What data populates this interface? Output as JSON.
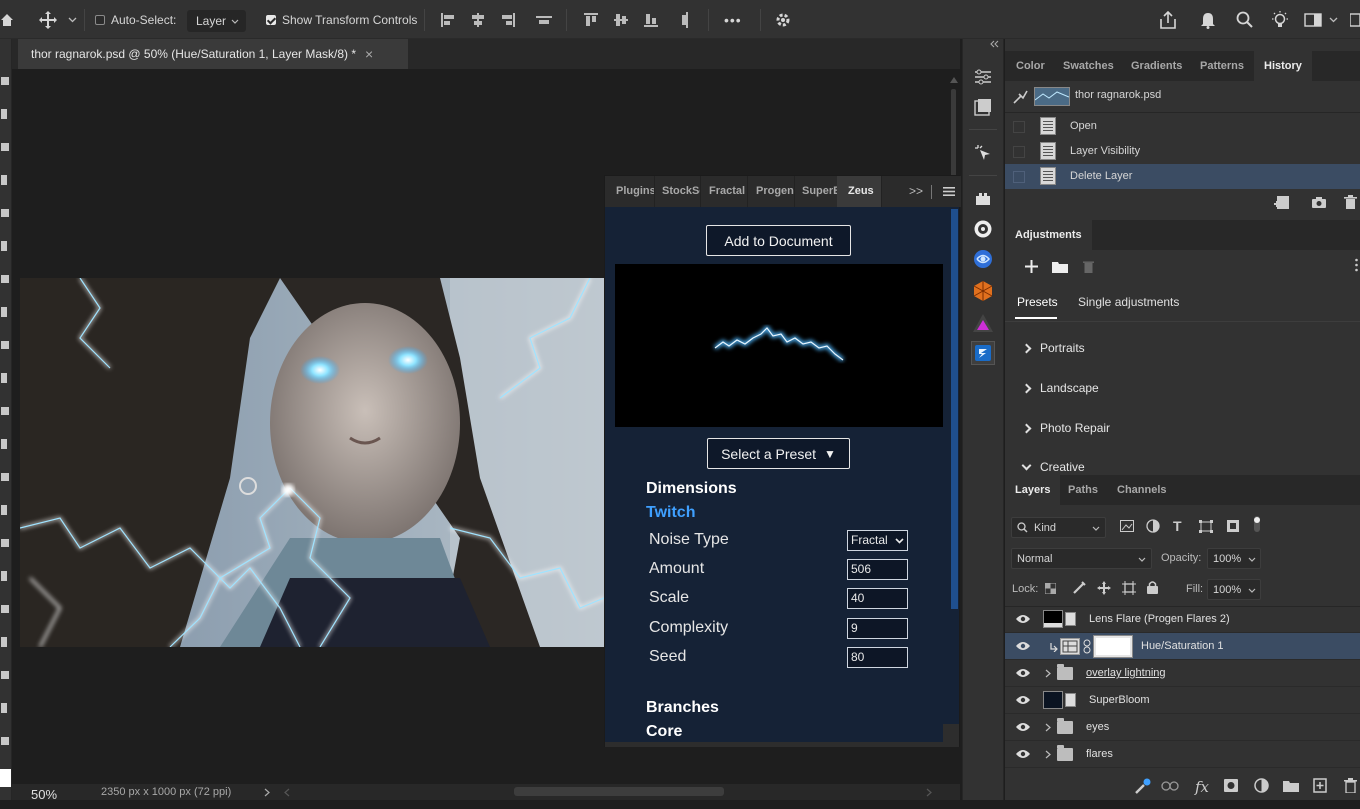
{
  "options_bar": {
    "auto_select_label": "Auto-Select:",
    "layer_select": "Layer",
    "show_transform_label": "Show Transform Controls",
    "more_label": "•••"
  },
  "document": {
    "tab_title": "thor ragnarok.psd @ 50% (Hue/Saturation 1, Layer Mask/8) *",
    "close_glyph": "×"
  },
  "status": {
    "zoom": "50%",
    "doc_size": "2350 px x 1000 px (72 ppi)"
  },
  "plugin_panel": {
    "tabs": [
      "Plugins",
      "StockSo",
      "Fractal",
      "Progen",
      "SuperB",
      "Zeus"
    ],
    "active_tab": "Zeus",
    "add_button": "Add to Document",
    "preset_button": "Select a Preset",
    "preset_caret": "▼",
    "section_dimensions": "Dimensions",
    "subsection_twitch": "Twitch",
    "fields": [
      {
        "label": "Noise Type",
        "value": "Fractal"
      },
      {
        "label": "Amount",
        "value": "506"
      },
      {
        "label": "Scale",
        "value": "40"
      },
      {
        "label": "Complexity",
        "value": "9"
      },
      {
        "label": "Seed",
        "value": "80"
      }
    ],
    "section_branches": "Branches",
    "section_core": "Core",
    "expand_glyph": ">>"
  },
  "history_panel": {
    "tabs": [
      "Color",
      "Swatches",
      "Gradients",
      "Patterns",
      "History"
    ],
    "active_tab": "History",
    "snapshot_name": "thor ragnarok.psd",
    "states": [
      "Open",
      "Layer Visibility",
      "Delete Layer"
    ],
    "selected_state": "Delete Layer"
  },
  "adjustments_panel": {
    "title": "Adjustments",
    "subtabs": [
      "Presets",
      "Single adjustments"
    ],
    "active_subtab": "Presets",
    "groups": [
      "Portraits",
      "Landscape",
      "Photo Repair",
      "Creative"
    ]
  },
  "layers_panel": {
    "tabs": [
      "Layers",
      "Paths",
      "Channels"
    ],
    "active_tab": "Layers",
    "filter_kind": "Kind",
    "blend_mode": "Normal",
    "opacity_label": "Opacity:",
    "opacity_value": "100%",
    "lock_label": "Lock:",
    "fill_label": "Fill:",
    "fill_value": "100%",
    "layers": [
      {
        "name": "Lens Flare (Progen Flares 2)",
        "kind": "smart"
      },
      {
        "name": "Hue/Saturation 1",
        "kind": "adjustment"
      },
      {
        "name": "overlay lightning",
        "kind": "group"
      },
      {
        "name": "SuperBloom",
        "kind": "smart"
      },
      {
        "name": "eyes",
        "kind": "group"
      },
      {
        "name": "flares",
        "kind": "group"
      }
    ],
    "selected_layer": "Hue/Saturation 1",
    "fx_label": "fx"
  },
  "colors": {
    "panel_bg": "#323232",
    "plugin_bg": "#152236",
    "selection": "#3b4c63",
    "accent_blue": "#3fa0ff"
  }
}
